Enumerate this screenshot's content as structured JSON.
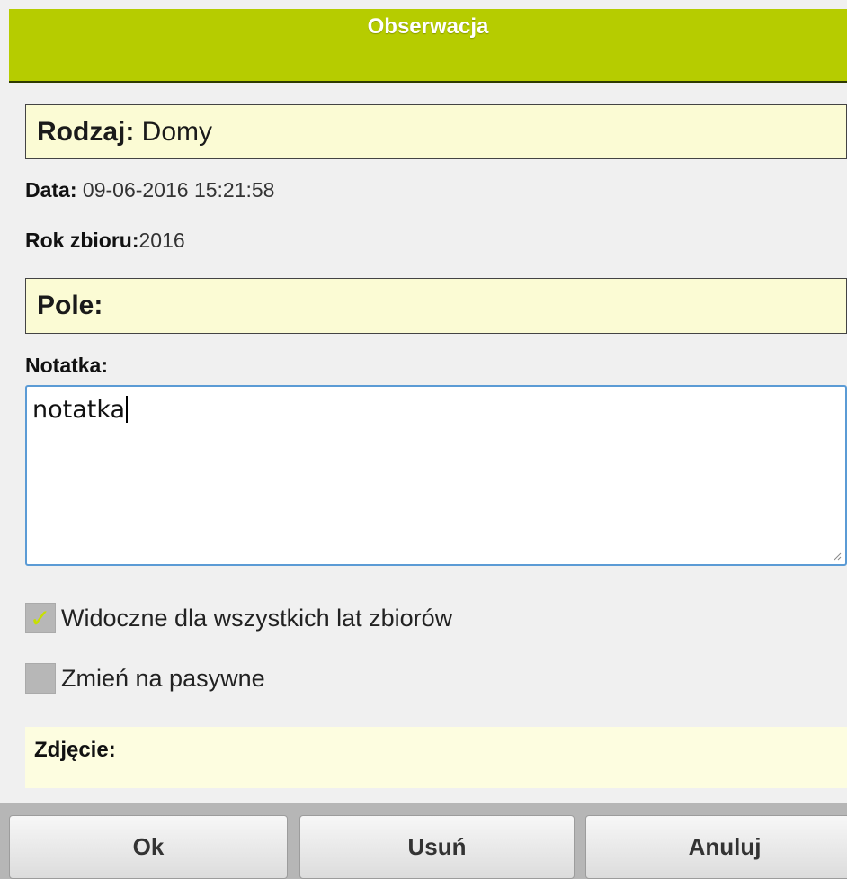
{
  "header": {
    "title": "Obserwacja"
  },
  "rodzaj": {
    "label": "Rodzaj:",
    "value": "Domy"
  },
  "data": {
    "label": "Data:",
    "value": "09-06-2016 15:21:58"
  },
  "rok": {
    "label": "Rok zbioru:",
    "value": "2016"
  },
  "pole": {
    "label": "Pole:"
  },
  "notatka": {
    "label": "Notatka:",
    "value": "notatka"
  },
  "checkboxes": [
    {
      "label": "Widoczne dla wszystkich lat zbiorów",
      "checked": true
    },
    {
      "label": "Zmień na pasywne",
      "checked": false
    }
  ],
  "photo": {
    "label": "Zdjęcie:"
  },
  "buttons": {
    "ok": "Ok",
    "usun": "Usuń",
    "anuluj": "Anuluj"
  },
  "colors": {
    "accent": "#b6cc00",
    "field_bg": "#fbfbd4",
    "checkmark": "#c7e000"
  }
}
